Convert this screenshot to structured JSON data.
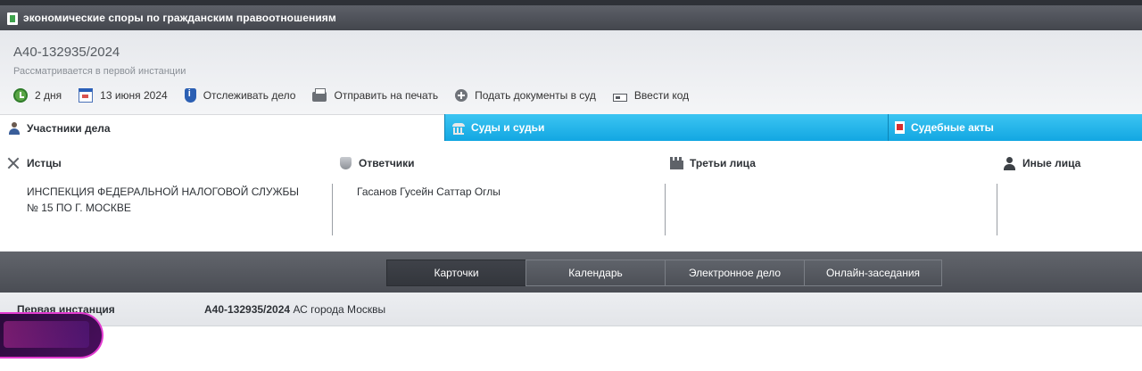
{
  "window": {
    "title": "экономические споры по гражданским правоотношениям"
  },
  "case": {
    "number": "А40-132935/2024",
    "status": "Рассматривается в первой инстанции"
  },
  "actions": [
    {
      "label": "2 дня",
      "icon": "clock-icon"
    },
    {
      "label": "13 июня 2024",
      "icon": "calendar-icon"
    },
    {
      "label": "Отслеживать дело",
      "icon": "shield-info-icon"
    },
    {
      "label": "Отправить на печать",
      "icon": "printer-icon"
    },
    {
      "label": "Подать документы в суд",
      "icon": "plus-circle-icon"
    },
    {
      "label": "Ввести код",
      "icon": "keyboard-icon"
    }
  ],
  "tabs": [
    {
      "label": "Участники дела",
      "icon": "person-icon",
      "active": true
    },
    {
      "label": "Суды и судьи",
      "icon": "courthouse-icon",
      "active": false
    },
    {
      "label": "Судебные акты",
      "icon": "pdf-icon",
      "active": false
    }
  ],
  "parties": {
    "plaintiffs": {
      "title": "Истцы",
      "icon": "swords-icon",
      "items": [
        "ИНСПЕКЦИЯ ФЕДЕРАЛЬНОЙ НАЛОГОВОЙ СЛУЖБЫ № 15 ПО Г. МОСКВЕ"
      ]
    },
    "defendants": {
      "title": "Ответчики",
      "icon": "shield-icon",
      "items": [
        "Гасанов Гусейн Саттар Оглы"
      ]
    },
    "third_parties": {
      "title": "Третьи лица",
      "icon": "fortress-icon",
      "items": []
    },
    "others": {
      "title": "Иные лица",
      "icon": "user-icon",
      "items": []
    }
  },
  "subtabs": [
    {
      "label": "Карточки",
      "active": true
    },
    {
      "label": "Календарь",
      "active": false
    },
    {
      "label": "Электронное дело",
      "active": false
    },
    {
      "label": "Онлайн-заседания",
      "active": false
    }
  ],
  "instance": {
    "label": "Первая инстанция",
    "case_number": "А40-132935/2024",
    "court": "АС города Москвы"
  },
  "colors": {
    "accent_tab": "#12a7e2",
    "header_dark": "#43464d",
    "navbar": "#4a4d54"
  }
}
